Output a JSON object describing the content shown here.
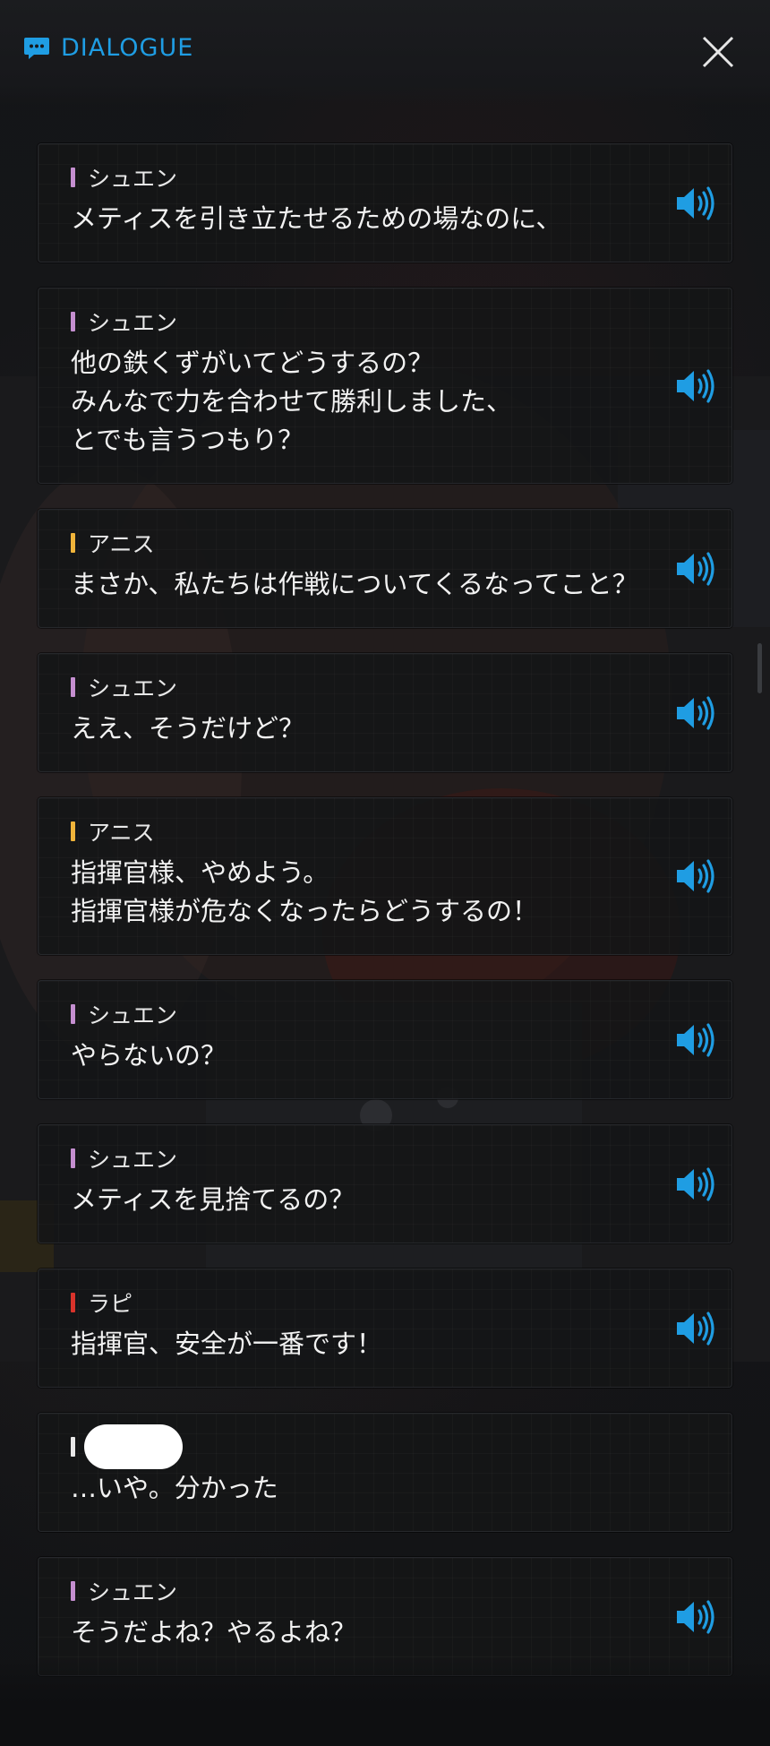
{
  "header": {
    "title": "DIALOGUE",
    "icon": "chat-bubble-icon",
    "close_icon": "close-icon",
    "accent_color": "#1f9de3"
  },
  "dialogue": [
    {
      "speaker": "シュエン",
      "speaker_color": "#c58fd0",
      "lines": [
        "メティスを引き立たせるための場なのに、"
      ],
      "has_voice": true
    },
    {
      "speaker": "シュエン",
      "speaker_color": "#c58fd0",
      "lines": [
        "他の鉄くずがいてどうするの？",
        "みんなで力を合わせて勝利しました、",
        "とでも言うつもり？"
      ],
      "has_voice": true
    },
    {
      "speaker": "アニス",
      "speaker_color": "#f0b43a",
      "lines": [
        "まさか、私たちは作戦についてくるなってこと？"
      ],
      "has_voice": true
    },
    {
      "speaker": "シュエン",
      "speaker_color": "#c58fd0",
      "lines": [
        "ええ、そうだけど？"
      ],
      "has_voice": true
    },
    {
      "speaker": "アニス",
      "speaker_color": "#f0b43a",
      "lines": [
        "指揮官様、やめよう。",
        "指揮官様が危なくなったらどうするの！"
      ],
      "has_voice": true
    },
    {
      "speaker": "シュエン",
      "speaker_color": "#c58fd0",
      "lines": [
        "やらないの？"
      ],
      "has_voice": true
    },
    {
      "speaker": "シュエン",
      "speaker_color": "#c58fd0",
      "lines": [
        "メティスを見捨てるの？"
      ],
      "has_voice": true
    },
    {
      "speaker": "ラピ",
      "speaker_color": "#d9332b",
      "lines": [
        "指揮官、安全が一番です！"
      ],
      "has_voice": true
    },
    {
      "speaker": "",
      "speaker_color": "#e8e8e8",
      "redacted": true,
      "lines": [
        "…いや。分かった"
      ],
      "has_voice": false
    },
    {
      "speaker": "シュエン",
      "speaker_color": "#c58fd0",
      "lines": [
        "そうだよね？やるよね？"
      ],
      "has_voice": true
    }
  ],
  "voice_icon": "speaker-volume-icon"
}
